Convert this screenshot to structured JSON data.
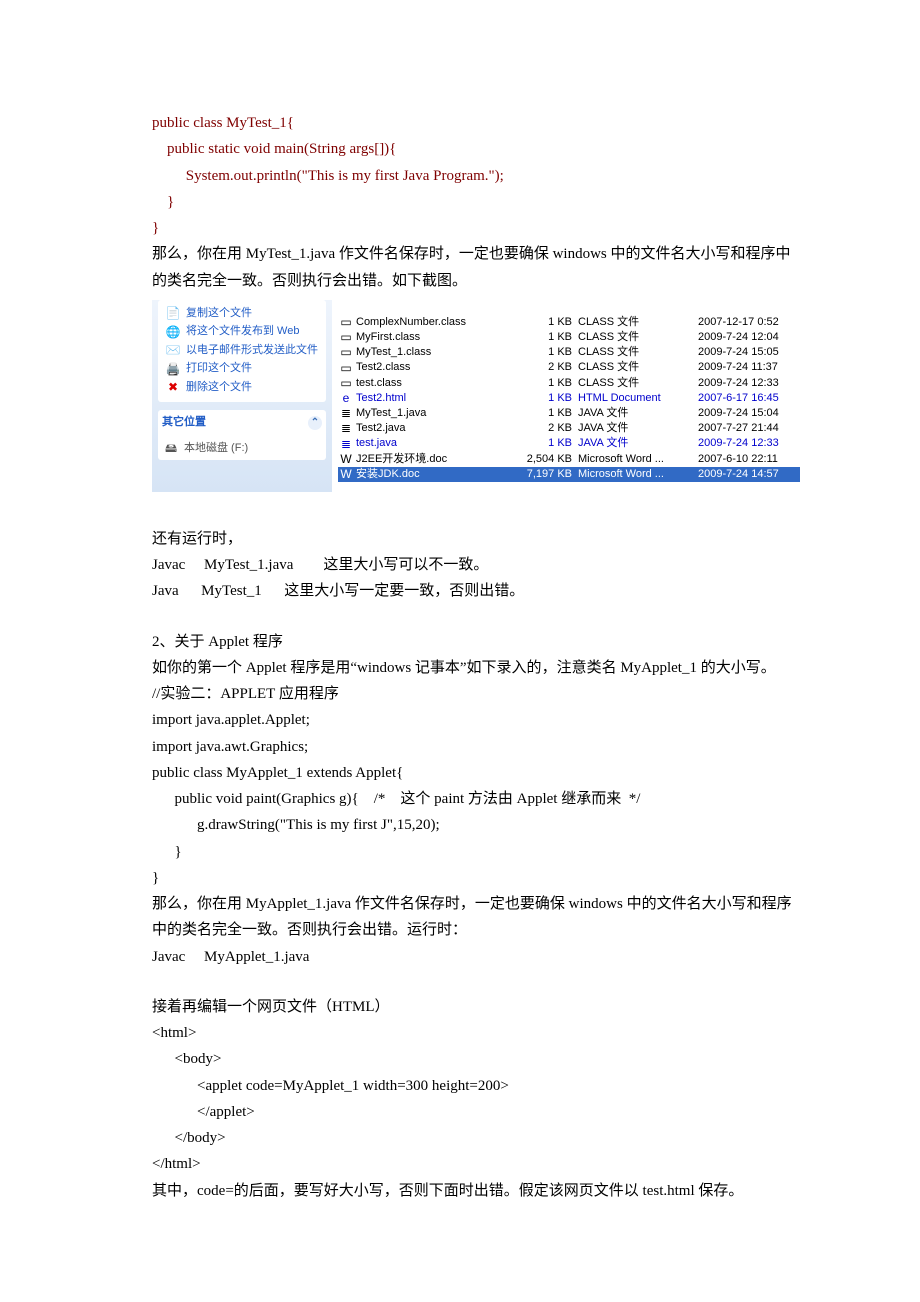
{
  "code1": [
    "public class MyTest_1{",
    "    public static void main(String args[]){",
    "         System.out.println(\"This is my first Java Program.\");",
    "    }",
    "}"
  ],
  "p1": "那么，你在用 MyTest_1.java 作文件名保存时，一定也要确保 windows 中的文件名大小写和程序中的类名完全一致。否则执行会出错。如下截图。",
  "tasks": {
    "items": [
      {
        "icon": "📄",
        "label": "复制这个文件"
      },
      {
        "icon": "🌐",
        "label": "将这个文件发布到 Web"
      },
      {
        "icon": "✉️",
        "label": "以电子邮件形式发送此文件"
      },
      {
        "icon": "🖨️",
        "label": "打印这个文件"
      },
      {
        "icon": "✖",
        "label": "删除这个文件",
        "red": true
      }
    ],
    "other_title": "其它位置",
    "other_item": "本地磁盘 (F:)"
  },
  "files": [
    {
      "ic": "▭",
      "name": "ComplexNumber.class",
      "size": "1 KB",
      "type": "CLASS 文件",
      "date": "2007-12-17 0:52"
    },
    {
      "ic": "▭",
      "name": "MyFirst.class",
      "size": "1 KB",
      "type": "CLASS 文件",
      "date": "2009-7-24 12:04"
    },
    {
      "ic": "▭",
      "name": "MyTest_1.class",
      "size": "1 KB",
      "type": "CLASS 文件",
      "date": "2009-7-24 15:05"
    },
    {
      "ic": "▭",
      "name": "Test2.class",
      "size": "2 KB",
      "type": "CLASS 文件",
      "date": "2009-7-24 11:37"
    },
    {
      "ic": "▭",
      "name": "test.class",
      "size": "1 KB",
      "type": "CLASS 文件",
      "date": "2009-7-24 12:33"
    },
    {
      "ic": "e",
      "name": "Test2.html",
      "size": "1 KB",
      "type": "HTML Document",
      "date": "2007-6-17 16:45",
      "blue": true
    },
    {
      "ic": "≣",
      "name": "MyTest_1.java",
      "size": "1 KB",
      "type": "JAVA 文件",
      "date": "2009-7-24 15:04"
    },
    {
      "ic": "≣",
      "name": "Test2.java",
      "size": "2 KB",
      "type": "JAVA 文件",
      "date": "2007-7-27 21:44"
    },
    {
      "ic": "≣",
      "name": "test.java",
      "size": "1 KB",
      "type": "JAVA 文件",
      "date": "2009-7-24 12:33",
      "blue": true
    },
    {
      "ic": "W",
      "name": "J2EE开发环境.doc",
      "size": "2,504 KB",
      "type": "Microsoft Word ...",
      "date": "2007-6-10 22:11"
    },
    {
      "ic": "W",
      "name": "安装JDK.doc",
      "size": "7,197 KB",
      "type": "Microsoft Word ...",
      "date": "2009-7-24 14:57",
      "sel": true
    }
  ],
  "p2": "还有运行时，",
  "p3": "Javac     MyTest_1.java        这里大小写可以不一致。",
  "p4": "Java      MyTest_1      这里大小写一定要一致，否则出错。",
  "p5": "2、关于 Applet 程序",
  "p6": "如你的第一个 Applet 程序是用“windows 记事本”如下录入的，注意类名 MyApplet_1 的大小写。",
  "code2": [
    "//实验二：APPLET 应用程序",
    "import java.applet.Applet;",
    "import java.awt.Graphics;",
    "public class MyApplet_1 extends Applet{",
    "      public void paint(Graphics g){    /*    这个 paint 方法由 Applet 继承而来  */",
    "            g.drawString(\"This is my first J\",15,20);",
    "      }",
    "}"
  ],
  "p7": "那么，你在用 MyApplet_1.java 作文件名保存时，一定也要确保 windows 中的文件名大小写和程序中的类名完全一致。否则执行会出错。运行时：",
  "p8": "Javac     MyApplet_1.java",
  "p9": "接着再编辑一个网页文件（HTML）",
  "code3": [
    "<html>",
    "      <body>",
    "            <applet code=MyApplet_1 width=300 height=200>",
    "",
    "            </applet>",
    "      </body>",
    "</html>"
  ],
  "p10": "其中，code=的后面，要写好大小写，否则下面时出错。假定该网页文件以 test.html 保存。"
}
